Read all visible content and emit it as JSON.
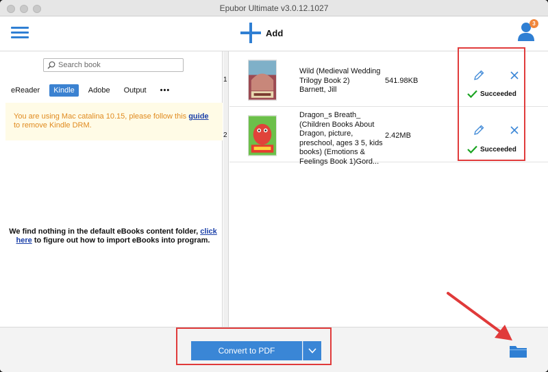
{
  "window": {
    "title": "Epubor Ultimate v3.0.12.1027"
  },
  "toolbar": {
    "menu_icon": "hamburger-menu-icon",
    "add_label": "Add",
    "user_badge_count": "3"
  },
  "sidebar": {
    "search_placeholder": "Search book",
    "tabs": [
      {
        "label": "eReader",
        "active": false
      },
      {
        "label": "Kindle",
        "active": true
      },
      {
        "label": "Adobe",
        "active": false
      },
      {
        "label": "Output",
        "active": false
      },
      {
        "label": "•••",
        "active": false
      }
    ],
    "notice": {
      "before": "You are using Mac catalina 10.15, please follow this ",
      "link": "guide",
      "after": " to remove Kindle DRM."
    },
    "empty": {
      "before": "We find nothing in the default eBooks content folder, ",
      "link": "click here",
      "after": " to figure out how to import eBooks into program."
    }
  },
  "books": [
    {
      "index": "1",
      "title": "Wild (Medieval Wedding Trilogy Book 2)",
      "author": "Barnett, Jill",
      "size": "541.98KB",
      "status": "Succeeded"
    },
    {
      "index": "2",
      "title": "Dragon_s Breath_ (Children Books About Dragon, picture, preschool, ages 3 5, kids books) (Emotions & Feelings Book 1)Gord...",
      "size": "2.42MB",
      "status": "Succeeded"
    }
  ],
  "bottom": {
    "convert_label": "Convert to PDF"
  },
  "colors": {
    "accent": "#3a86d6",
    "success": "#1aa321",
    "annotation": "#e03a3a",
    "notice_text": "#e08a1e"
  }
}
